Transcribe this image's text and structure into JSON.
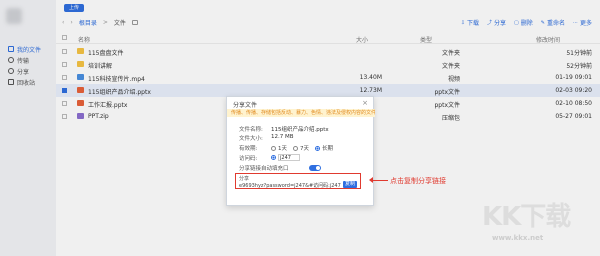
{
  "sidebar": {
    "items": [
      {
        "label": "我的文件",
        "icon": "folder-icon",
        "active": true
      },
      {
        "label": "传输",
        "icon": "transfer-icon",
        "active": false
      },
      {
        "label": "分享",
        "icon": "share-icon",
        "active": false
      },
      {
        "label": "回收站",
        "icon": "trash-icon",
        "active": false
      }
    ]
  },
  "toolbar": {
    "upload_label": "上传"
  },
  "breadcrumb": {
    "root": "根目录",
    "sep": ">",
    "current": "文件"
  },
  "actions": [
    {
      "label": "下载",
      "icon": "download-icon"
    },
    {
      "label": "分享",
      "icon": "share-icon"
    },
    {
      "label": "删除",
      "icon": "delete-icon"
    },
    {
      "label": "重命名",
      "icon": "rename-icon"
    },
    {
      "label": "更多",
      "icon": "more-icon"
    }
  ],
  "table": {
    "columns": {
      "name": "名称",
      "size": "大小",
      "type": "类型",
      "time": "修改时间"
    },
    "rows": [
      {
        "name": "115盘盘文件",
        "size": "",
        "type": "文件夹",
        "time": "51分钟前",
        "kind": "folder"
      },
      {
        "name": "培训讲解",
        "size": "",
        "type": "文件夹",
        "time": "52分钟前",
        "kind": "folder"
      },
      {
        "name": "115科技宣传片.mp4",
        "size": "13.40M",
        "type": "视频",
        "time": "01-19 09:01",
        "kind": "video"
      },
      {
        "name": "115组织产品介绍.pptx",
        "size": "12.73M",
        "type": "pptx文件",
        "time": "02-03 09:20",
        "kind": "ppt",
        "selected": true
      },
      {
        "name": "工作汇报.pptx",
        "size": "",
        "type": "pptx文件",
        "time": "02-10 08:50",
        "kind": "ppt"
      },
      {
        "name": "PPT.zip",
        "size": "",
        "type": "压缩包",
        "time": "05-27 09:01",
        "kind": "zip"
      }
    ]
  },
  "dialog": {
    "title": "分享文件",
    "close": "×",
    "warning": "传播、传播、存储包括反动、暴力、色情、违法及侵权内容的文件",
    "filename_label": "文件名称:",
    "filename": "115组织产品介绍.pptx",
    "filesize_label": "文件大小:",
    "filesize": "12.7 MB",
    "validity_label": "有效期:",
    "validity_options": [
      "1天",
      "7天",
      "长期"
    ],
    "validity_selected": 2,
    "code_label": "访问码:",
    "code_value": "j247",
    "autofill_label": "分享链接自动填充口",
    "autofill_on": true,
    "link_label": "分享",
    "link_url": "e9693hyz?password=j247&#访问码:j247",
    "copy_label": "复制"
  },
  "annotation": {
    "text": "点击复制分享链接",
    "color": "#e03a2f"
  },
  "watermark": {
    "logo": "KK下载",
    "url": "www.kkx.net"
  }
}
